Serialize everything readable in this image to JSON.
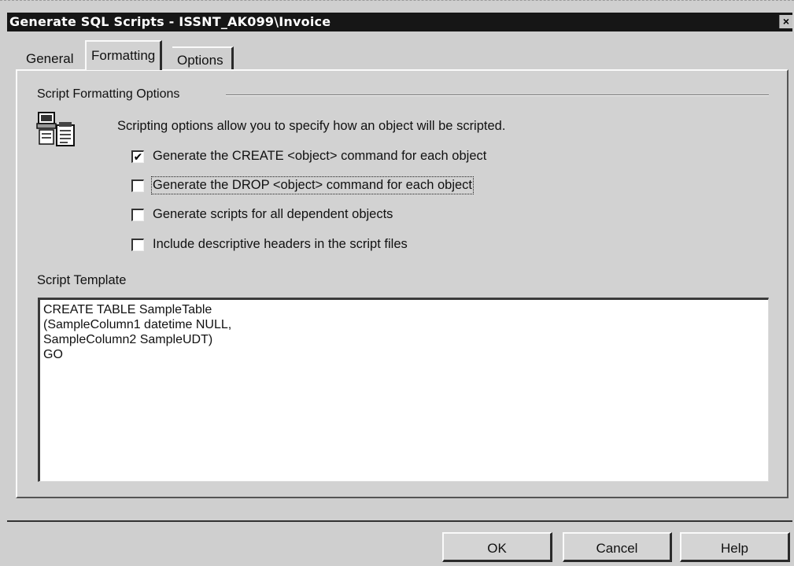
{
  "window": {
    "title": "Generate SQL Scripts - ISSNT_AK099\\Invoice",
    "close_label": "×"
  },
  "tabs": [
    {
      "label": "General",
      "active": false
    },
    {
      "label": "Formatting",
      "active": true
    },
    {
      "label": "Options",
      "active": false
    }
  ],
  "formatting": {
    "group_label": "Script Formatting Options",
    "icon": "script-document-icon",
    "description": "Scripting options allow you to specify how an object will be scripted.",
    "options": [
      {
        "label": "Generate the CREATE <object> command for each object",
        "checked": true,
        "check_glyph": "✔"
      },
      {
        "label": "Generate the DROP <object> command for each object",
        "checked": false,
        "check_glyph": ""
      },
      {
        "label": "Generate scripts for all dependent objects",
        "checked": false,
        "check_glyph": ""
      },
      {
        "label": "Include descriptive headers in the script files",
        "checked": false,
        "check_glyph": ""
      }
    ]
  },
  "template": {
    "label": "Script Template",
    "lines": [
      "CREATE TABLE SampleTable",
      "(SampleColumn1 datetime NULL,",
      "SampleColumn2 SampleUDT)",
      "GO"
    ]
  },
  "buttons": {
    "ok": "OK",
    "cancel": "Cancel",
    "help": "Help"
  }
}
